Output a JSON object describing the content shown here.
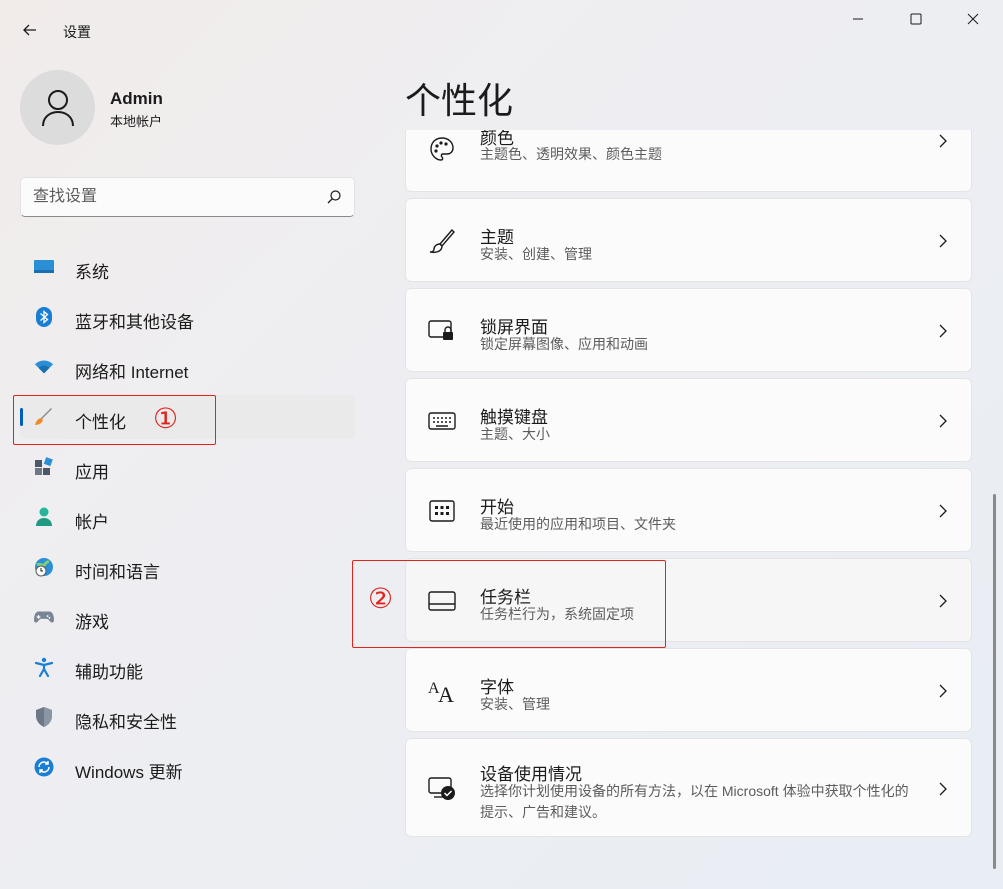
{
  "window": {
    "app_title": "设置",
    "back_icon": "back-arrow-icon",
    "minimize_icon": "minimize-icon",
    "maximize_icon": "maximize-icon",
    "close_icon": "close-icon"
  },
  "profile": {
    "name": "Admin",
    "account_type": "本地帐户",
    "avatar_icon": "user-avatar-icon"
  },
  "search": {
    "placeholder": "查找设置",
    "icon": "search-icon"
  },
  "sidebar": {
    "items": [
      {
        "label": "系统",
        "icon": "system-display-icon",
        "active": false
      },
      {
        "label": "蓝牙和其他设备",
        "icon": "bluetooth-icon",
        "active": false
      },
      {
        "label": "网络和 Internet",
        "icon": "wifi-icon",
        "active": false
      },
      {
        "label": "个性化",
        "icon": "paintbrush-icon",
        "active": true
      },
      {
        "label": "应用",
        "icon": "apps-icon",
        "active": false
      },
      {
        "label": "帐户",
        "icon": "person-icon",
        "active": false
      },
      {
        "label": "时间和语言",
        "icon": "globe-clock-icon",
        "active": false
      },
      {
        "label": "游戏",
        "icon": "gamepad-icon",
        "active": false
      },
      {
        "label": "辅助功能",
        "icon": "accessibility-icon",
        "active": false
      },
      {
        "label": "隐私和安全性",
        "icon": "shield-icon",
        "active": false
      },
      {
        "label": "Windows 更新",
        "icon": "update-sync-icon",
        "active": false
      }
    ]
  },
  "annotations": {
    "marker_1": "①",
    "marker_2": "②",
    "color": "#e0231c"
  },
  "main": {
    "page_title": "个性化",
    "cards": [
      {
        "title": "颜色",
        "description": "主题色、透明效果、颜色主题",
        "icon": "palette-icon"
      },
      {
        "title": "主题",
        "description": "安装、创建、管理",
        "icon": "brush-icon"
      },
      {
        "title": "锁屏界面",
        "description": "锁定屏幕图像、应用和动画",
        "icon": "lock-screen-icon"
      },
      {
        "title": "触摸键盘",
        "description": "主题、大小",
        "icon": "keyboard-icon"
      },
      {
        "title": "开始",
        "description": "最近使用的应用和项目、文件夹",
        "icon": "start-menu-icon"
      },
      {
        "title": "任务栏",
        "description": "任务栏行为，系统固定项",
        "icon": "taskbar-icon"
      },
      {
        "title": "字体",
        "description": "安装、管理",
        "icon": "font-icon"
      },
      {
        "title": "设备使用情况",
        "description": "选择你计划使用设备的所有方法，以在 Microsoft 体验中获取个性化的提示、广告和建议。",
        "icon": "device-usage-icon"
      }
    ]
  },
  "colors": {
    "accent": "#005fb8",
    "annotation_red": "#e0231c"
  }
}
